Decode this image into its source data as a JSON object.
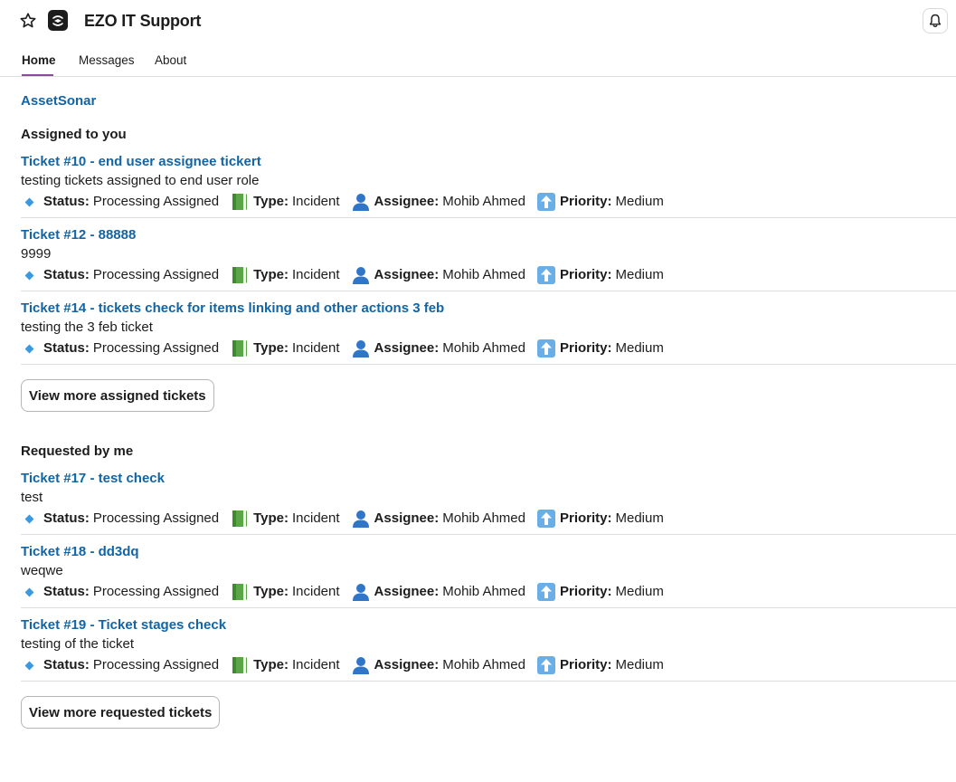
{
  "header": {
    "title": "EZO IT Support",
    "star_icon": "star-icon",
    "app_icon": "ezo-app-icon",
    "bell_icon": "bell-icon"
  },
  "tabs": [
    {
      "label": "Home",
      "active": true
    },
    {
      "label": "Messages",
      "active": false
    },
    {
      "label": "About",
      "active": false
    }
  ],
  "main": {
    "asset_link": "AssetSonar",
    "labels": {
      "status": "Status:",
      "type": "Type:",
      "assignee": "Assignee:",
      "priority": "Priority:"
    },
    "assigned": {
      "title": "Assigned to you",
      "more_button": "View more assigned tickets",
      "tickets": [
        {
          "title": "Ticket #10 - end user assignee tickert",
          "description": "testing tickets assigned to end user role",
          "status": "Processing Assigned",
          "type": "Incident",
          "assignee": "Mohib Ahmed",
          "priority": "Medium"
        },
        {
          "title": "Ticket #12 - 88888",
          "description": "9999",
          "status": "Processing Assigned",
          "type": "Incident",
          "assignee": "Mohib Ahmed",
          "priority": "Medium"
        },
        {
          "title": "Ticket #14 - tickets check for items linking and other actions 3 feb",
          "description": "testing the 3 feb ticket",
          "status": "Processing Assigned",
          "type": "Incident",
          "assignee": "Mohib Ahmed",
          "priority": "Medium"
        }
      ]
    },
    "requested": {
      "title": "Requested by me",
      "more_button": "View more requested tickets",
      "tickets": [
        {
          "title": "Ticket #17 - test check",
          "description": "test",
          "status": "Processing Assigned",
          "type": "Incident",
          "assignee": "Mohib Ahmed",
          "priority": "Medium"
        },
        {
          "title": "Ticket #18 - dd3dq",
          "description": "weqwe",
          "status": "Processing Assigned",
          "type": "Incident",
          "assignee": "Mohib Ahmed",
          "priority": "Medium"
        },
        {
          "title": "Ticket #19 - Ticket stages check",
          "description": "testing of the ticket",
          "status": "Processing Assigned",
          "type": "Incident",
          "assignee": "Mohib Ahmed",
          "priority": "Medium"
        }
      ]
    }
  },
  "colors": {
    "link": "#1264a3",
    "tab_underline": "#8a4c9a",
    "status_diamond": "#3a9ae0",
    "type_book": "#5aa546",
    "assignee_person": "#2f76c9",
    "priority_arrow": "#6aaee8"
  },
  "icons": {
    "status": "blue-diamond-icon",
    "type": "green-book-icon",
    "assignee": "person-silhouette-icon",
    "priority": "up-arrow-icon"
  }
}
